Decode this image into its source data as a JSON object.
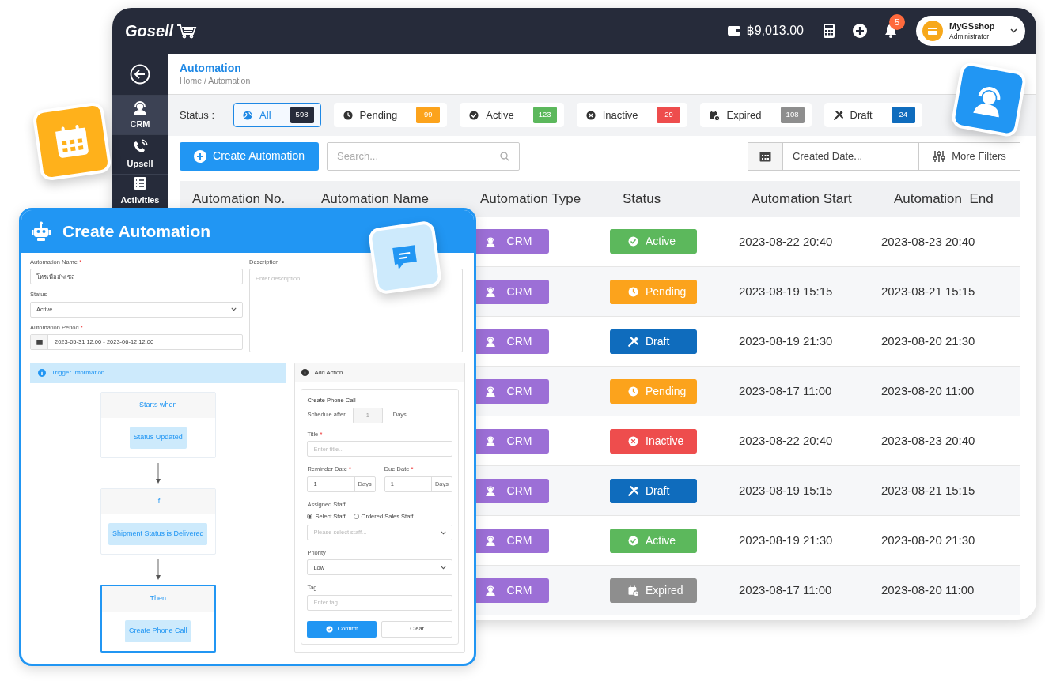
{
  "header": {
    "logo": "Gosell",
    "balance": "฿9,013.00",
    "notification_count": "5",
    "user": {
      "name": "MyGSshop",
      "role": "Administrator"
    }
  },
  "sidebar": {
    "items": [
      {
        "label": "CRM",
        "kind": "crm",
        "selected": true
      },
      {
        "label": "Upsell",
        "kind": "upsell",
        "selected": false
      },
      {
        "label": "Activities",
        "kind": "activities",
        "selected": false
      }
    ]
  },
  "page": {
    "title": "Automation",
    "breadcrumb": "Home / Automation"
  },
  "status_filter": {
    "label": "Status :",
    "items": [
      {
        "label": "All",
        "count": "598",
        "kind": "all",
        "selected": true
      },
      {
        "label": "Pending",
        "count": "99",
        "kind": "pending",
        "selected": false
      },
      {
        "label": "Active",
        "count": "123",
        "kind": "active",
        "selected": false
      },
      {
        "label": "Inactive",
        "count": "29",
        "kind": "inactive",
        "selected": false
      },
      {
        "label": "Expired",
        "count": "108",
        "kind": "expired",
        "selected": false
      },
      {
        "label": "Draft",
        "count": "24",
        "kind": "draft",
        "selected": false
      }
    ]
  },
  "toolbar": {
    "create_button": "Create Automation",
    "search_placeholder": "Search...",
    "date_placeholder": "Created Date...",
    "more_filters": "More Filters"
  },
  "table": {
    "columns": [
      "Automation No.",
      "Automation Name",
      "Automation Type",
      "Status",
      "Automation Start",
      "Automation  End"
    ],
    "rows": [
      {
        "type": "CRM",
        "status": {
          "label": "Active",
          "kind": "active"
        },
        "start": "2023-08-22 20:40",
        "end": "2023-08-23 20:40"
      },
      {
        "type": "CRM",
        "status": {
          "label": "Pending",
          "kind": "pending"
        },
        "start": "2023-08-19 15:15",
        "end": "2023-08-21 15:15"
      },
      {
        "type": "CRM",
        "status": {
          "label": "Draft",
          "kind": "draft"
        },
        "start": "2023-08-19 21:30",
        "end": "2023-08-20 21:30"
      },
      {
        "type": "CRM",
        "status": {
          "label": "Pending",
          "kind": "pending"
        },
        "start": "2023-08-17 11:00",
        "end": "2023-08-20 11:00"
      },
      {
        "type": "CRM",
        "status": {
          "label": "Inactive",
          "kind": "inactive"
        },
        "start": "2023-08-22 20:40",
        "end": "2023-08-23 20:40"
      },
      {
        "type": "CRM",
        "status": {
          "label": "Draft",
          "kind": "draft"
        },
        "start": "2023-08-19 15:15",
        "end": "2023-08-21 15:15"
      },
      {
        "type": "CRM",
        "status": {
          "label": "Active",
          "kind": "active"
        },
        "start": "2023-08-19 21:30",
        "end": "2023-08-20 21:30"
      },
      {
        "type": "CRM",
        "status": {
          "label": "Expired",
          "kind": "expired"
        },
        "start": "2023-08-17 11:00",
        "end": "2023-08-20 11:00"
      }
    ]
  },
  "create_panel": {
    "title": "Create Automation",
    "fields": [
      {
        "label": "Automation Name",
        "required_mark": "*",
        "kind": "text",
        "value": "โทรเพื่ออัพเซล"
      },
      {
        "label": "Status",
        "kind": "select",
        "value": "Active"
      },
      {
        "label": "Automation Period",
        "required_mark": "*",
        "kind": "date",
        "value": "2023-05-31 12:00 - 2023-06-12 12:00"
      }
    ],
    "description": {
      "label": "Description",
      "placeholder": "Enter description..."
    },
    "trigger_title": "Trigger Information",
    "flow": [
      {
        "heading": "Starts when",
        "item": "Status Updated",
        "selected": false
      },
      {
        "heading": "If",
        "item": "Shipment Status is Delivered",
        "selected": false
      },
      {
        "heading": "Then",
        "item": "Create Phone Call",
        "selected": true
      }
    ],
    "action": {
      "title": "Add Action",
      "subtitle": "Create Phone Call",
      "schedule": {
        "label": "Schedule after",
        "value": "1",
        "unit": "Days"
      },
      "title_field": {
        "label": "Title",
        "required_mark": "*",
        "placeholder": "Enter title..."
      },
      "reminder": {
        "label": "Reminder Date",
        "required_mark": "*",
        "value": "1",
        "unit": "Days"
      },
      "due": {
        "label": "Due Date",
        "required_mark": "*",
        "value": "1",
        "unit": "Days"
      },
      "staff_label": "Assigned Staff",
      "staff_options": [
        {
          "label": "Select Staff",
          "selected": true
        },
        {
          "label": "Ordered Sales Staff",
          "selected": false
        }
      ],
      "staff_placeholder": "Please select staff...",
      "priority": {
        "label": "Priority",
        "value": "Low"
      },
      "tag": {
        "label": "Tag",
        "placeholder": "Enter tag..."
      },
      "confirm": "Confirm",
      "clear": "Clear"
    }
  }
}
